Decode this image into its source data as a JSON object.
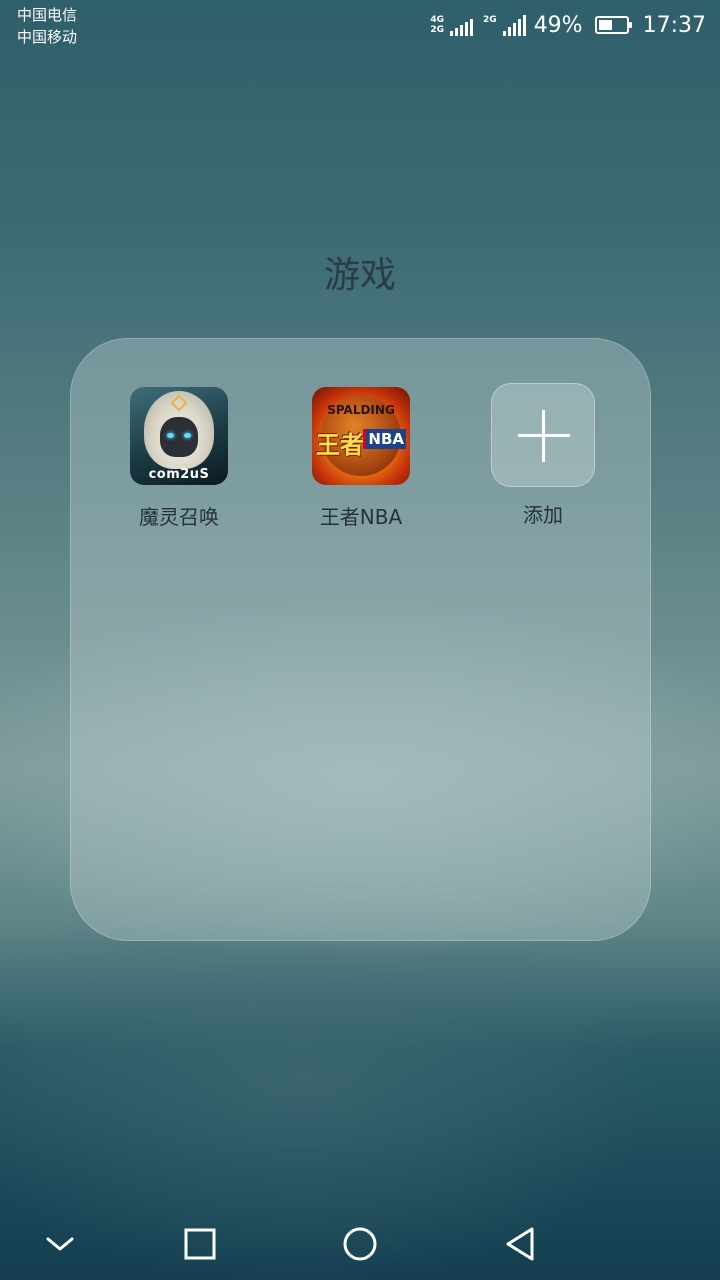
{
  "status_bar": {
    "carrier_1": "中国电信",
    "carrier_2": "中国移动",
    "network_sim1_top": "4G",
    "network_sim1_bottom": "2G",
    "network_sim2": "2G",
    "battery_percent": "49%",
    "battery_level": 0.49,
    "time": "17:37"
  },
  "folder": {
    "title": "游戏",
    "apps": [
      {
        "label": "魔灵召唤",
        "icon": "summoners-war-app-icon",
        "brand_text": "com2uS"
      },
      {
        "label": "王者NBA",
        "icon": "nba-king-app-icon",
        "brand_text": "SPALDING",
        "logo_text": "王者",
        "badge_text": "NBA"
      }
    ],
    "add": {
      "label": "添加",
      "icon": "plus-icon"
    }
  },
  "nav_bar": {
    "buttons": [
      {
        "name": "collapse",
        "icon": "chevron-down-icon"
      },
      {
        "name": "recents",
        "icon": "square-icon"
      },
      {
        "name": "home",
        "icon": "circle-icon"
      },
      {
        "name": "back",
        "icon": "triangle-back-icon"
      }
    ]
  }
}
